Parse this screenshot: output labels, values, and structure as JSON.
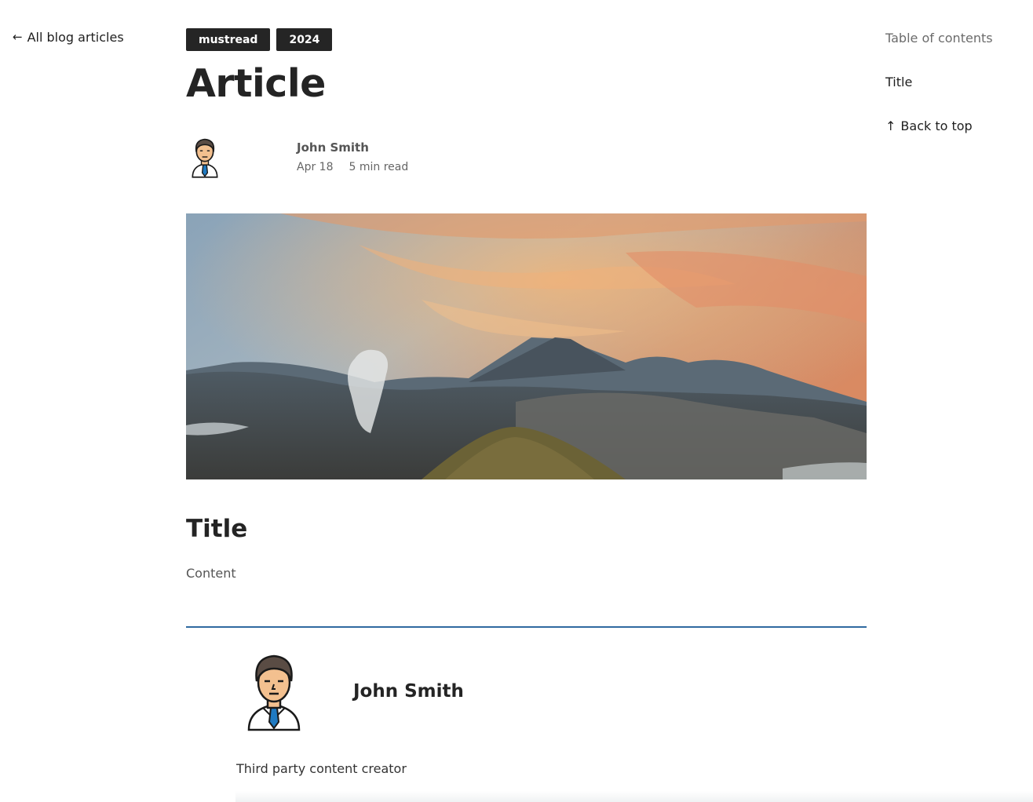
{
  "nav": {
    "back_label": "All blog articles",
    "back_icon": "arrow-left-icon"
  },
  "tags": [
    "mustread",
    "2024"
  ],
  "article": {
    "title": "Article",
    "author": "John Smith",
    "date": "Apr 18",
    "read_time": "5 min read",
    "hero_image": "volcano-landscape-sunset"
  },
  "section": {
    "title": "Title",
    "content": "Content"
  },
  "bio": {
    "name": "John Smith",
    "role": "Third party content creator"
  },
  "toc": {
    "heading": "Table of contents",
    "items": [
      "Title"
    ],
    "back_to_top": "Back to top",
    "back_to_top_icon": "arrow-up-icon"
  },
  "colors": {
    "tag_bg": "#252525",
    "divider": "#2f6aa0",
    "text": "#242424"
  }
}
